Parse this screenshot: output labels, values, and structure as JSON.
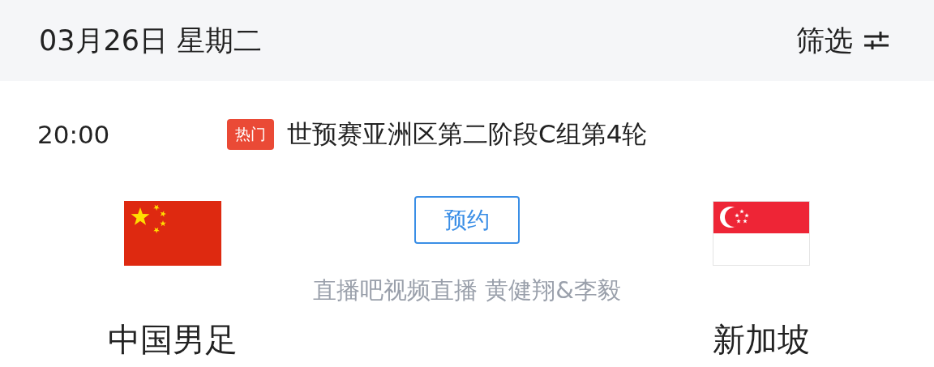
{
  "header": {
    "date": "03月26日 星期二",
    "filter_label": "筛选"
  },
  "match": {
    "time": "20:00",
    "badge": "热门",
    "competition": "世预赛亚洲区第二阶段C组第4轮",
    "teams": [
      {
        "name": "中国男足"
      },
      {
        "name": "新加坡"
      }
    ],
    "reserve_button": "预约",
    "broadcast": "直播吧视频直播 黄健翔&李毅"
  }
}
